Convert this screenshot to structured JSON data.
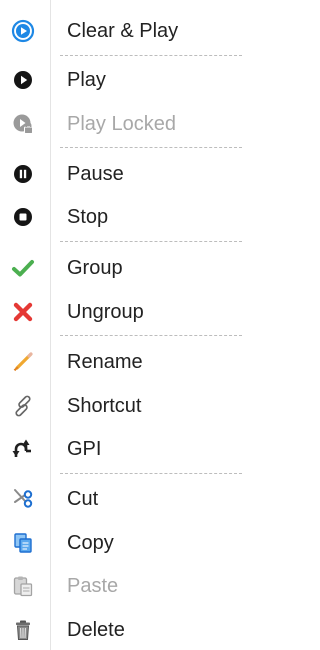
{
  "menu": {
    "items": [
      {
        "label": "Clear & Play",
        "icon": "clear-play-icon"
      },
      {
        "label": "Play",
        "icon": "play-icon"
      },
      {
        "label": "Play Locked",
        "icon": "play-locked-icon"
      },
      {
        "label": "Pause",
        "icon": "pause-icon"
      },
      {
        "label": "Stop",
        "icon": "stop-icon"
      },
      {
        "label": "Group",
        "icon": "checkmark-icon"
      },
      {
        "label": "Ungroup",
        "icon": "x-icon"
      },
      {
        "label": "Rename",
        "icon": "pencil-icon"
      },
      {
        "label": "Shortcut",
        "icon": "paperclip-icon"
      },
      {
        "label": "GPI",
        "icon": "gpi-icon"
      },
      {
        "label": "Cut",
        "icon": "scissors-icon"
      },
      {
        "label": "Copy",
        "icon": "copy-icon"
      },
      {
        "label": "Paste",
        "icon": "paste-icon"
      },
      {
        "label": "Delete",
        "icon": "trash-icon"
      }
    ]
  },
  "colors": {
    "accent_blue": "#1e88e5",
    "green_check": "#4caf50",
    "red_x": "#e53935",
    "disabled_text": "#a8a8a8"
  }
}
